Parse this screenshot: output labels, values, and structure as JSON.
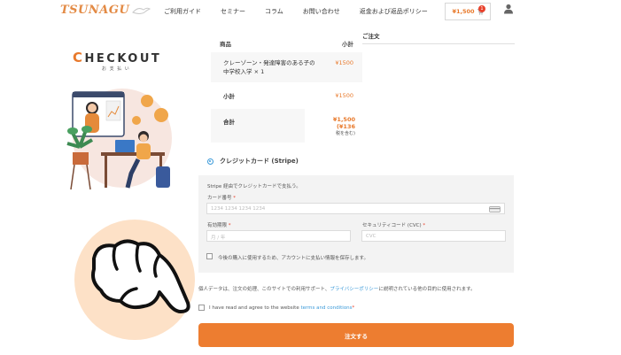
{
  "header": {
    "logo_text": "TSUNAGU",
    "nav": [
      "ご利用ガイド",
      "セミナー",
      "コラム",
      "お問い合わせ",
      "返金および返品ポリシー"
    ],
    "cart_price": "¥1,500",
    "cart_count": "1",
    "accent_color": "#e8792b"
  },
  "left": {
    "title_first": "C",
    "title_rest": "HECKOUT",
    "subtitle": "お 支 払 い"
  },
  "summary": {
    "col_product": "商品",
    "col_subtotal": "小計",
    "order_tab": "ご注文",
    "product_name": "クレーゾーン・発達障害のある子の中学校入学 × 1",
    "product_price": "¥1500",
    "subtotal_label": "小計",
    "subtotal_value": "¥1500",
    "total_label": "合計",
    "total_value": "¥1,500 (¥136",
    "tax_note": "税を含む)"
  },
  "payment": {
    "method": "クレジットカード (Stripe)",
    "description": "Stripe 経由でクレジットカードで支払う。",
    "card_number_label": "カード番号",
    "card_number_placeholder": "1234 1234 1234 1234",
    "expiry_label": "有効期限",
    "expiry_placeholder": "月 / 年",
    "cvc_label": "セキュリティコード (CVC)",
    "cvc_placeholder": "CVC",
    "save_label": "今後の購入に使用するため、アカウントに支払い情報を保存します。",
    "required_mark": "*"
  },
  "footer": {
    "privacy_before": "個人データは、注文の処理、このサイトでの利用サポート、",
    "privacy_link": "プライバシーポリシー",
    "privacy_after": "に説明されている他の目的に使用されます。",
    "terms_before": "I have read and agree to the website ",
    "terms_link": "terms and conditions",
    "terms_req": "*",
    "order_button": "注文する"
  }
}
